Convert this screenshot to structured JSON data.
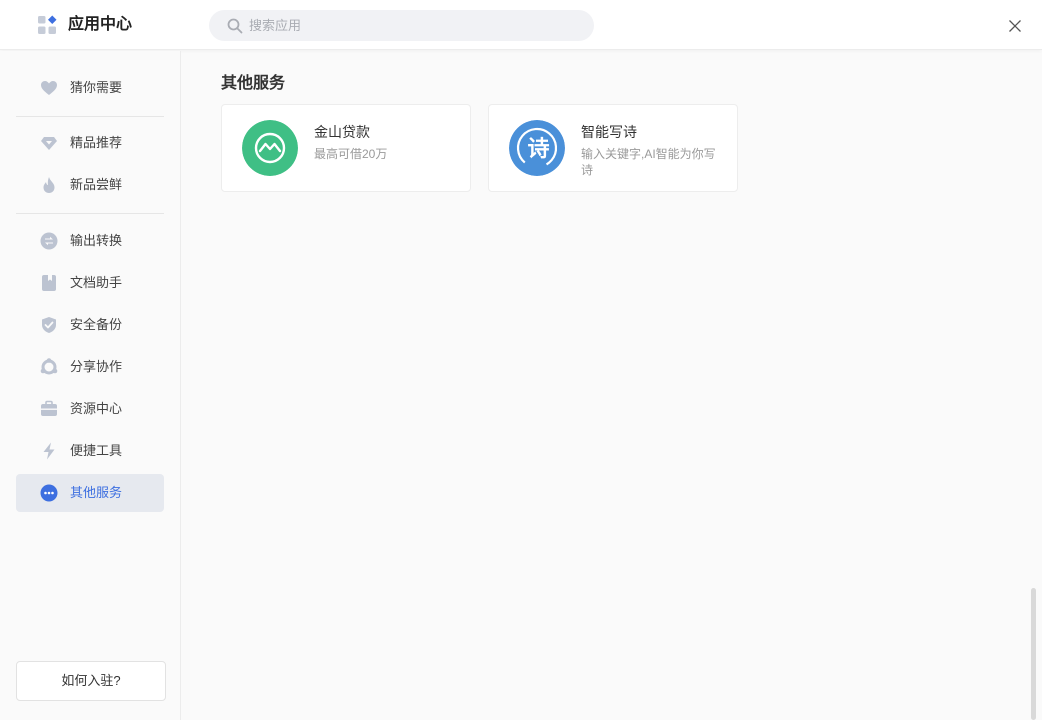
{
  "header": {
    "title": "应用中心",
    "logo_icon": "apps-grid-icon",
    "search": {
      "placeholder": "搜索应用",
      "value": ""
    },
    "close_icon": "close-icon"
  },
  "sidebar": {
    "items": [
      {
        "label": "猜你需要",
        "icon": "heart-icon"
      },
      {
        "label": "精品推荐",
        "icon": "diamond-icon"
      },
      {
        "label": "新品尝鲜",
        "icon": "flame-icon"
      },
      {
        "label": "输出转换",
        "icon": "convert-icon"
      },
      {
        "label": "文档助手",
        "icon": "book-icon"
      },
      {
        "label": "安全备份",
        "icon": "shield-check-icon"
      },
      {
        "label": "分享协作",
        "icon": "share-ring-icon"
      },
      {
        "label": "资源中心",
        "icon": "briefcase-icon"
      },
      {
        "label": "便捷工具",
        "icon": "lightning-icon"
      },
      {
        "label": "其他服务",
        "icon": "more-dots-icon",
        "active": true
      }
    ],
    "join_label": "如何入驻?"
  },
  "main": {
    "section_title": "其他服务",
    "cards": [
      {
        "name": "金山贷款",
        "desc": "最高可借20万",
        "icon": "loan-icon",
        "color": "#3fbf85"
      },
      {
        "name": "智能写诗",
        "desc": "输入关键字,AI智能为你写诗",
        "icon": "poem-icon",
        "color": "#4a90d9",
        "glyph": "诗"
      }
    ]
  },
  "colors": {
    "accent": "#3d6fe0",
    "icon_gray": "#bcc3d1"
  }
}
